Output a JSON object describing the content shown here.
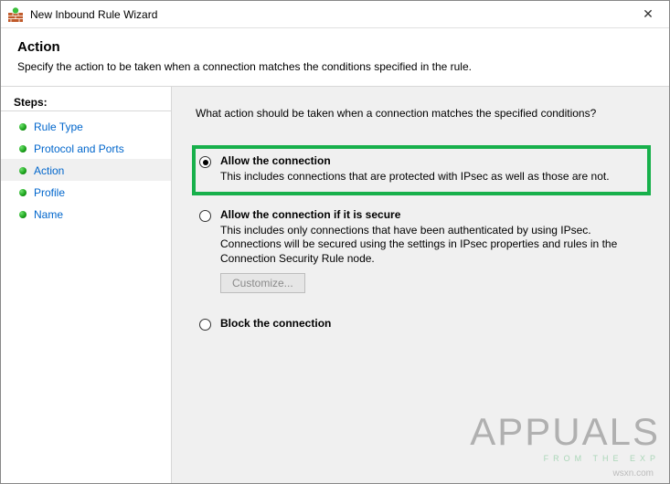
{
  "window": {
    "title": "New Inbound Rule Wizard",
    "close": "✕"
  },
  "header": {
    "title": "Action",
    "subtitle": "Specify the action to be taken when a connection matches the conditions specified in the rule."
  },
  "sidebar": {
    "label": "Steps:",
    "steps": [
      {
        "label": "Rule Type",
        "selected": false
      },
      {
        "label": "Protocol and Ports",
        "selected": false
      },
      {
        "label": "Action",
        "selected": true
      },
      {
        "label": "Profile",
        "selected": false
      },
      {
        "label": "Name",
        "selected": false
      }
    ]
  },
  "content": {
    "prompt": "What action should be taken when a connection matches the specified conditions?",
    "options": [
      {
        "title": "Allow the connection",
        "desc": "This includes connections that are protected with IPsec as well as those are not.",
        "selected": true,
        "highlighted": true
      },
      {
        "title": "Allow the connection if it is secure",
        "desc": "This includes only connections that have been authenticated by using IPsec. Connections will be secured using the settings in IPsec properties and rules in the Connection Security Rule node.",
        "selected": false,
        "highlighted": false,
        "customize_label": "Customize..."
      },
      {
        "title": "Block the connection",
        "desc": "",
        "selected": false,
        "highlighted": false
      }
    ]
  },
  "watermark": {
    "main": "APPUALS",
    "sub": "FROM THE EXP",
    "site": "wsxn.com"
  }
}
